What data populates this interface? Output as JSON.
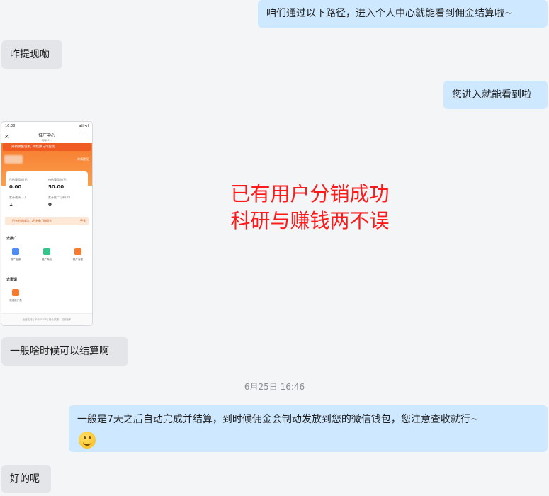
{
  "messages": [
    {
      "side": "mine",
      "text": "咱们通过以下路径，进入个人中心就能看到佣金结算啦~"
    },
    {
      "side": "theirs",
      "text": "咋提现嘞"
    },
    {
      "side": "mine",
      "text": "您进入就能看到啦"
    },
    {
      "side": "theirs",
      "text": "一般啥时候可以结算啊"
    },
    {
      "side": "mine",
      "text": "一般是7天之后自动完成并结算，到时候佣金会制动发放到您的微信钱包，您注意查收就行~"
    },
    {
      "side": "theirs",
      "text": "好的呢"
    }
  ],
  "timestamp": "6月25日 16:46",
  "overlay": {
    "line1": "已有用户分销成功",
    "line2": "科研与赚钱两不误",
    "color": "#ff1a1a"
  },
  "phone": {
    "time": "16:38",
    "signal": "atl ⊲l",
    "title": "推广中心",
    "subtitle": "app.c...",
    "banner": "分销佣金说明, 待结算与可提现",
    "link": "申请提现",
    "stats": [
      {
        "label": "已结算佣金(元)",
        "value": "0.00"
      },
      {
        "label": "待结算佣金(元)",
        "value": "50.00"
      },
      {
        "label": "累计邀请(人)",
        "value": "1"
      },
      {
        "label": "累计推广订单(个)",
        "value": "0"
      }
    ],
    "notice": "已有分销成功，赶快推广赚佣金",
    "notice_action": "更多",
    "section1": "去推广",
    "tools": [
      "推广店铺",
      "推广商品",
      "推广海报"
    ],
    "section2": "去邀请",
    "invite": "邀请推广员",
    "footer": "运营支持 | 卡卡SHOP | 隐私政策 | 当前版本"
  },
  "accent": "#cde8ff"
}
